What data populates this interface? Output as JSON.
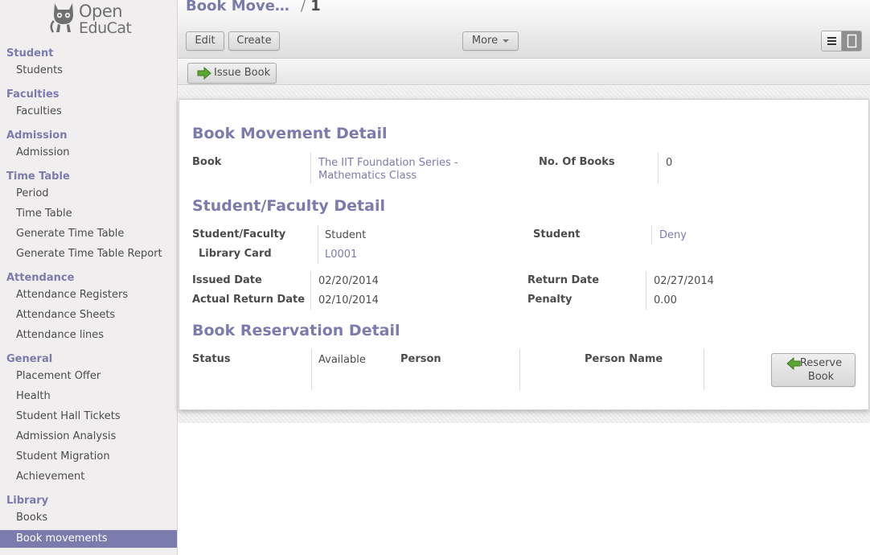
{
  "app": {
    "logo_line1": "Open",
    "logo_line2": "EduCat"
  },
  "sidebar": {
    "sections": [
      {
        "title": "Student",
        "items": [
          "Students"
        ]
      },
      {
        "title": "Faculties",
        "items": [
          "Faculties"
        ]
      },
      {
        "title": "Admission",
        "items": [
          "Admission"
        ]
      },
      {
        "title": "Time Table",
        "items": [
          "Period",
          "Time Table",
          "Generate Time Table",
          "Generate Time Table Report"
        ]
      },
      {
        "title": "Attendance",
        "items": [
          "Attendance Registers",
          "Attendance Sheets",
          "Attendance lines"
        ]
      },
      {
        "title": "General",
        "items": [
          "Placement Offer",
          "Health",
          "Student Hall Tickets",
          "Admission Analysis",
          "Student Migration",
          "Achievement"
        ]
      },
      {
        "title": "Library",
        "items": [
          "Books",
          "Book movements"
        ]
      }
    ]
  },
  "header": {
    "breadcrumb": "Book Move…",
    "separator": "/",
    "record_num": "1"
  },
  "toolbar": {
    "edit": "Edit",
    "create": "Create",
    "more": "More"
  },
  "statusbar": {
    "issue_book": "Issue Book"
  },
  "form": {
    "book_movement_title": "Book Movement Detail",
    "book_label": "Book",
    "book_value": "The IIT Foundation Series - Mathematics Class",
    "no_of_books_label": "No. Of Books",
    "no_of_books_value": "0",
    "student_faculty_title": "Student/Faculty Detail",
    "student_faculty_label": "Student/Faculty",
    "student_faculty_value": "Student",
    "student_label": "Student",
    "student_value": "Deny",
    "library_card_label": "Library Card",
    "library_card_value": "L0001",
    "issued_date_label": "Issued Date",
    "issued_date_value": "02/20/2014",
    "return_date_label": "Return Date",
    "return_date_value": "02/27/2014",
    "actual_return_label": "Actual Return Date",
    "actual_return_value": "02/10/2014",
    "penalty_label": "Penalty",
    "penalty_value": "0.00",
    "reservation_title": "Book Reservation Detail",
    "status_label": "Status",
    "status_value": "Available",
    "person_label": "Person",
    "person_name_label": "Person Name",
    "reserve_book": "Reserve Book"
  },
  "colors": {
    "accent": "#7c7bad",
    "arrow": "#5aa633"
  }
}
